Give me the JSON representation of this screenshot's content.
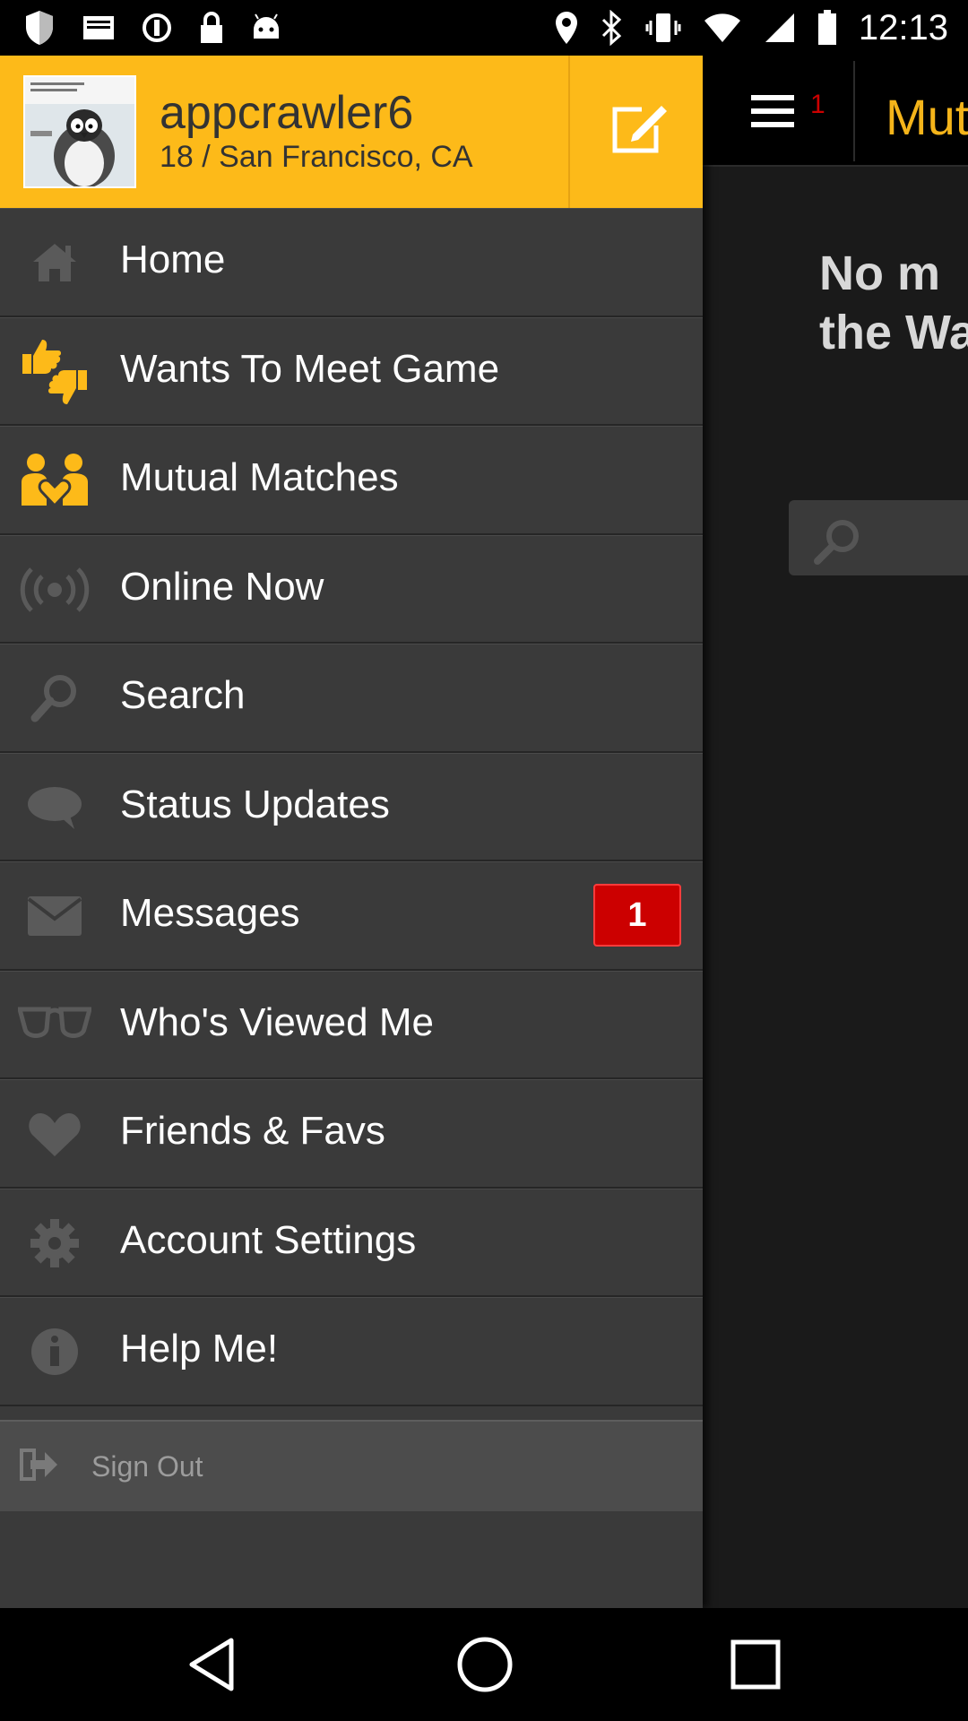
{
  "status_bar": {
    "time": "12:13",
    "icons": [
      "shield-icon",
      "mail-icon",
      "sync-icon",
      "lock-icon",
      "android-icon",
      "location-icon",
      "bluetooth-icon",
      "vibrate-icon",
      "wifi-icon",
      "signal-icon",
      "battery-icon"
    ]
  },
  "profile": {
    "username": "appcrawler6",
    "location": "18 / San Francisco, CA",
    "compose_icon": "compose-icon"
  },
  "menu": {
    "items": [
      {
        "label": "Home",
        "icon": "home-icon"
      },
      {
        "label": "Wants To Meet Game",
        "icon": "thumbs-up-down-icon"
      },
      {
        "label": "Mutual Matches",
        "icon": "couple-heart-icon"
      },
      {
        "label": "Online Now",
        "icon": "broadcast-icon"
      },
      {
        "label": "Search",
        "icon": "search-icon"
      },
      {
        "label": "Status Updates",
        "icon": "speech-bubble-icon"
      },
      {
        "label": "Messages",
        "icon": "envelope-icon",
        "badge": "1"
      },
      {
        "label": "Who's Viewed Me",
        "icon": "glasses-icon"
      },
      {
        "label": "Friends & Favs",
        "icon": "heart-icon"
      },
      {
        "label": "Account Settings",
        "icon": "gear-icon"
      },
      {
        "label": "Help Me!",
        "icon": "info-icon"
      }
    ],
    "signout_label": "Sign Out",
    "signout_icon": "sign-out-icon"
  },
  "background": {
    "menu_count": "1",
    "title": "Mut",
    "message_line1": "No m",
    "message_line2": "the Wa"
  },
  "colors": {
    "accent": "#fdba19",
    "badge": "#cc0000",
    "drawer": "#3a3a3a",
    "background_title": "#f4b41a"
  },
  "navbar": {
    "icons": [
      "back-icon",
      "home-circle-icon",
      "recents-icon"
    ]
  }
}
